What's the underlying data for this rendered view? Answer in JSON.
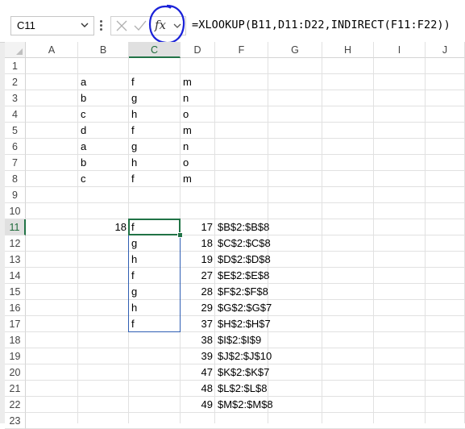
{
  "formula_bar": {
    "name_box": "C11",
    "fx_label": "fx",
    "formula": "=XLOOKUP(B11,D11:D22,INDIRECT(F11:F22))"
  },
  "columns": [
    "A",
    "B",
    "C",
    "D",
    "F",
    "G",
    "H",
    "I",
    "J"
  ],
  "rows": [
    "1",
    "2",
    "3",
    "4",
    "5",
    "6",
    "7",
    "8",
    "9",
    "10",
    "11",
    "12",
    "13",
    "14",
    "15",
    "16",
    "17",
    "18",
    "19",
    "20",
    "21",
    "22",
    "23"
  ],
  "selected_column": "C",
  "selected_row": "11",
  "cells": {
    "B2": "a",
    "C2": "f",
    "D2": "m",
    "B3": "b",
    "C3": "g",
    "D3": "n",
    "B4": "c",
    "C4": "h",
    "D4": "o",
    "B5": "d",
    "C5": "f",
    "D5": "m",
    "B6": "a",
    "C6": "g",
    "D6": "n",
    "B7": "b",
    "C7": "h",
    "D7": "o",
    "B8": "c",
    "C8": "f",
    "D8": "m",
    "B11": "18",
    "C11": "f",
    "D11": "17",
    "F11": "$B$2:$B$8",
    "C12": "g",
    "D12": "18",
    "F12": "$C$2:$C$8",
    "C13": "h",
    "D13": "19",
    "F13": "$D$2:$D$8",
    "C14": "f",
    "D14": "27",
    "F14": "$E$2:$E$8",
    "C15": "g",
    "D15": "28",
    "F15": "$F$2:$F$8",
    "C16": "h",
    "D16": "29",
    "F16": "$G$2:$G$7",
    "C17": "f",
    "D17": "37",
    "F17": "$H$2:$H$7",
    "D18": "38",
    "F18": "$I$2:$I$9",
    "D19": "39",
    "F19": "$J$2:$J$10",
    "D20": "47",
    "F20": "$K$2:$K$7",
    "D21": "48",
    "F21": "$L$2:$L$8",
    "D22": "49",
    "F22": "$M$2:$M$8"
  },
  "colors": {
    "selection": "#217346",
    "spill_border": "#2f5fb3",
    "annotation_circle": "#1a22d8"
  },
  "icons": [
    "chevron-down-icon",
    "more-options-icon",
    "cancel-icon",
    "enter-check-icon",
    "insert-function-icon"
  ]
}
